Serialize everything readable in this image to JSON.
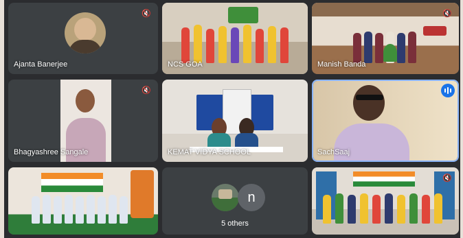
{
  "participants": {
    "ajanta": {
      "name": "Ajanta Banerjee"
    },
    "ncs_goa": {
      "name": "NCS GOA"
    },
    "manish": {
      "name": "Manish Banda"
    },
    "bhagyashree": {
      "name": "Bhagyashree Sangale"
    },
    "school": {
      "name": "KEMAT VIDYA SCHOOL"
    },
    "sachsaaj": {
      "name": "SachSaaj"
    },
    "group_tile": {
      "name": ""
    },
    "others": {
      "label": "5 others",
      "initial": "n"
    },
    "children": {
      "name": ""
    }
  },
  "colors": {
    "tile_bg": "#3c4043",
    "speaking_border": "#8ab4f8",
    "speaking_badge": "#1a73e8"
  },
  "icons": {
    "muted": "mic-off-icon",
    "speaking": "audio-level-icon"
  }
}
